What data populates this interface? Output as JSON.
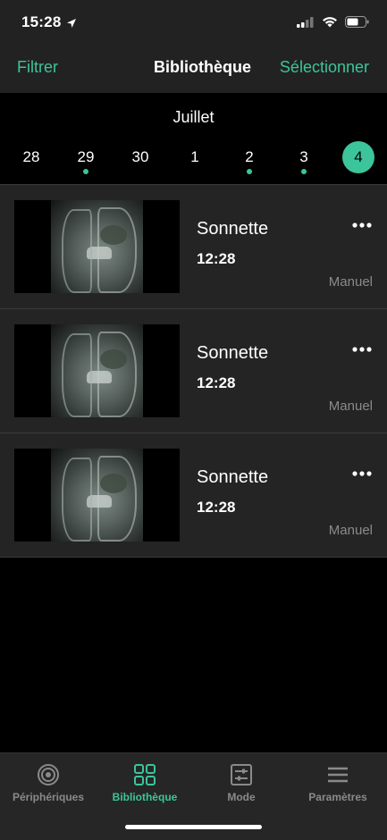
{
  "status_bar": {
    "time": "15:28"
  },
  "nav": {
    "left_label": "Filtrer",
    "title": "Bibliothèque",
    "right_label": "Sélectionner"
  },
  "date_strip": {
    "month": "Juillet",
    "days": [
      {
        "label": "28",
        "has_clips": false,
        "selected": false
      },
      {
        "label": "29",
        "has_clips": true,
        "selected": false
      },
      {
        "label": "30",
        "has_clips": false,
        "selected": false
      },
      {
        "label": "1",
        "has_clips": false,
        "selected": false
      },
      {
        "label": "2",
        "has_clips": true,
        "selected": false
      },
      {
        "label": "3",
        "has_clips": true,
        "selected": false
      },
      {
        "label": "4",
        "has_clips": false,
        "selected": true
      }
    ]
  },
  "clips": [
    {
      "title": "Sonnette",
      "time": "12:28",
      "mode": "Manuel"
    },
    {
      "title": "Sonnette",
      "time": "12:28",
      "mode": "Manuel"
    },
    {
      "title": "Sonnette",
      "time": "12:28",
      "mode": "Manuel"
    }
  ],
  "tabbar": {
    "tabs": [
      {
        "label": "Périphériques",
        "icon": "devices-icon",
        "active": false
      },
      {
        "label": "Bibliothèque",
        "icon": "library-grid-icon",
        "active": true
      },
      {
        "label": "Mode",
        "icon": "mode-sliders-icon",
        "active": false
      },
      {
        "label": "Paramètres",
        "icon": "menu-icon",
        "active": false
      }
    ]
  },
  "colors": {
    "accent": "#3cc59a",
    "background": "#000000",
    "surface": "#242424"
  }
}
